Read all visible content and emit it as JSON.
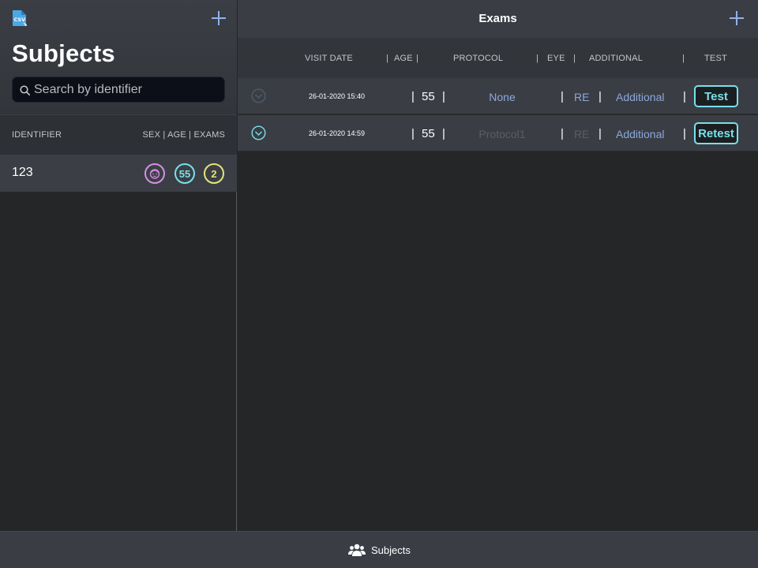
{
  "colors": {
    "accent": "#8fb3ea",
    "sex_badge": "#d58fe4",
    "age_badge": "#79e0ea",
    "exams_badge": "#e4e379",
    "test_button": "#79e0ea"
  },
  "left_panel": {
    "icons": {
      "export": "csv-file-icon",
      "add": "plus-icon"
    },
    "title": "Subjects",
    "search": {
      "placeholder": "Search by identifier",
      "value": ""
    },
    "columns": {
      "identifier": "IDENTIFIER",
      "right": "SEX | AGE | EXAMS"
    },
    "subjects": [
      {
        "identifier": "123",
        "sex_icon": "female-face-icon",
        "age": "55",
        "exams": "2"
      }
    ]
  },
  "right_panel": {
    "title": "Exams",
    "icons": {
      "add": "plus-icon"
    },
    "columns": {
      "visit_date": "VISIT DATE",
      "sep1": "|",
      "age": "AGE",
      "sep2": "|",
      "protocol": "PROTOCOL",
      "sep3": "|",
      "eye": "EYE",
      "sep4": "|",
      "additional": "ADDITIONAL",
      "sep5": "|",
      "test": "TEST"
    },
    "rows": [
      {
        "visit_date": "26-01-2020 15:40",
        "age": "55",
        "protocol": "None",
        "protocol_color": "#8aa8dc",
        "eye": "RE",
        "eye_color": "#8aa8dc",
        "additional": "Additional",
        "test_label": "Test",
        "chevron": "chevron-down-circle-icon",
        "sep": "|"
      },
      {
        "visit_date": "26-01-2020 14:59",
        "age": "55",
        "protocol": "Protocol1",
        "protocol_color": "#5a5e64",
        "eye": "RE",
        "eye_color": "#5a5e64",
        "additional": "Additional",
        "test_label": "Retest",
        "chevron": "chevron-down-circle-icon",
        "sep": "|"
      }
    ]
  },
  "tabbar": {
    "tabs": [
      {
        "label": "Subjects",
        "icon": "people-group-icon"
      }
    ]
  }
}
